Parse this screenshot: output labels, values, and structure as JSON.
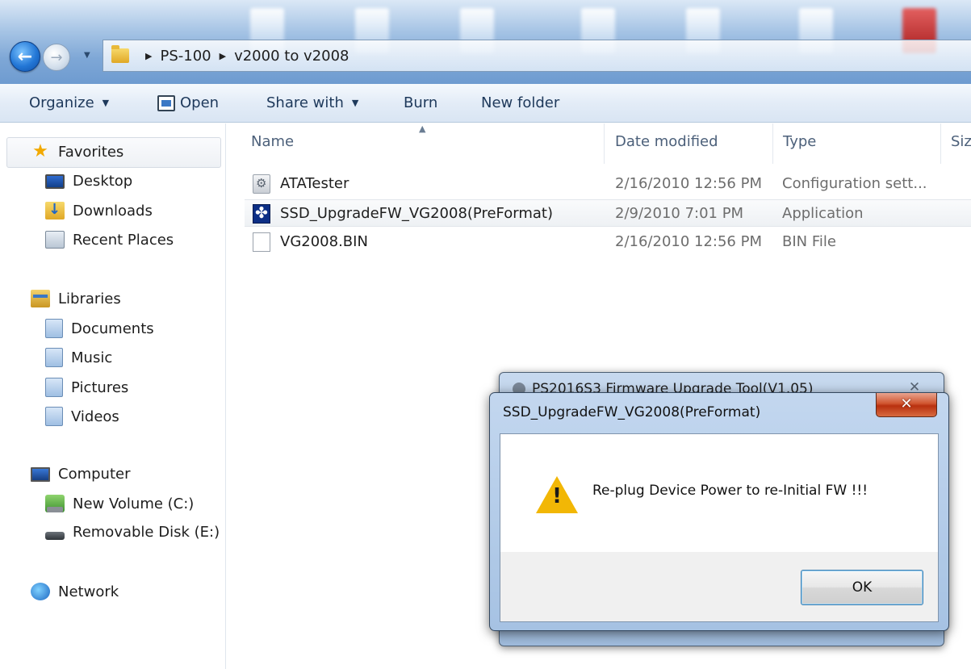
{
  "address": {
    "crumbs": [
      "PS-100",
      "v2000 to v2008"
    ]
  },
  "toolbar": {
    "organize": "Organize",
    "open": "Open",
    "share_with": "Share with",
    "burn": "Burn",
    "new_folder": "New folder"
  },
  "navpane": {
    "favorites": "Favorites",
    "desktop": "Desktop",
    "downloads": "Downloads",
    "recent_places": "Recent Places",
    "libraries": "Libraries",
    "documents": "Documents",
    "music": "Music",
    "pictures": "Pictures",
    "videos": "Videos",
    "computer": "Computer",
    "new_volume": "New Volume (C:)",
    "removable_disk": "Removable Disk (E:)",
    "network": "Network"
  },
  "columns": {
    "name": "Name",
    "date_modified": "Date modified",
    "type": "Type",
    "size": "Size"
  },
  "files": [
    {
      "name": "ATATester",
      "date": "2/16/2010 12:56 PM",
      "type": "Configuration sett..."
    },
    {
      "name": "SSD_UpgradeFW_VG2008(PreFormat)",
      "date": "2/9/2010 7:01 PM",
      "type": "Application"
    },
    {
      "name": "VG2008.BIN",
      "date": "2/16/2010 12:56 PM",
      "type": "BIN File"
    }
  ],
  "dialog_back": {
    "title": "PS2016S3 Firmware Upgrade Tool(V1.05)",
    "close": "✕"
  },
  "dialog": {
    "title": "SSD_UpgradeFW_VG2008(PreFormat)",
    "close": "✕",
    "message": "Re-plug Device Power to re-Initial FW !!!",
    "ok": "OK"
  }
}
